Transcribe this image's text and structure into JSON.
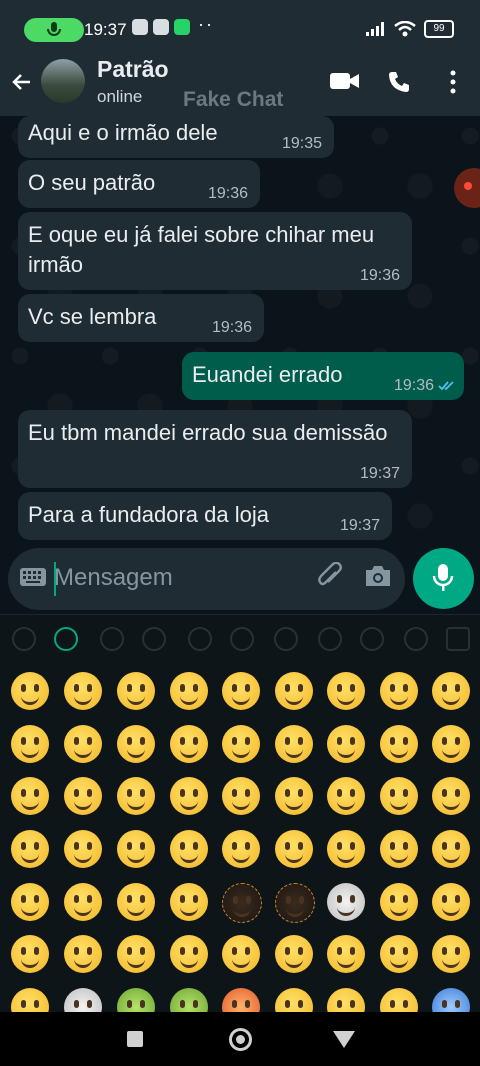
{
  "status_bar": {
    "time": "19:37",
    "battery": "99"
  },
  "header": {
    "contact_name": "Patrão",
    "presence": "online",
    "watermark": "Fake Chat"
  },
  "messages": [
    {
      "direction": "in",
      "text": "Aqui e o irmão dele",
      "time": "19:35"
    },
    {
      "direction": "in",
      "text": "O seu patrão",
      "time": "19:36"
    },
    {
      "direction": "in",
      "text": "E oque eu já falei sobre chihar meu irmão",
      "time": "19:36"
    },
    {
      "direction": "in",
      "text": "Vc se lembra",
      "time": "19:36"
    },
    {
      "direction": "out",
      "text": "Euandei errado",
      "time": "19:36",
      "status": "read"
    },
    {
      "direction": "in",
      "text": "Eu tbm mandei errado sua demissão",
      "time": "19:37"
    },
    {
      "direction": "in",
      "text": "Para a fundadora da loja",
      "time": "19:37"
    }
  ],
  "composer": {
    "placeholder": "Mensagem"
  },
  "emoji_picker": {
    "active_category": "smileys",
    "categories": [
      "recent-icon",
      "smileys-icon",
      "animals-icon",
      "food-icon",
      "activities-icon",
      "travel-icon",
      "objects-icon",
      "symbols-icon",
      "flags-icon",
      "backspace-icon"
    ],
    "emojis": [
      "😀",
      "😃",
      "😄",
      "😁",
      "😆",
      "😅",
      "🤣",
      "😂",
      "🙂",
      "🙃",
      "🫠",
      "😉",
      "😊",
      "😇",
      "🥰",
      "😍",
      "🤩",
      "😘",
      "😗",
      "☺️",
      "😚",
      "😙",
      "🥲",
      "😋",
      "😛",
      "😜",
      "🤪",
      "😝",
      "🤑",
      "🤗",
      "🤭",
      "🫢",
      "🫣",
      "🤫",
      "🤔",
      "🫡",
      "🤐",
      "🤨",
      "😐",
      "😑",
      "😶",
      "🫥",
      "😶‍🌫️",
      "😏",
      "😒",
      "🙄",
      "😬",
      "😮‍💨",
      "🤥",
      "🫨",
      "😌",
      "😔",
      "😪",
      "🤤",
      "😴",
      "😷",
      "🤒",
      "🤕",
      "🤢",
      "🤮",
      "🤧",
      "🥵",
      "🥶"
    ]
  },
  "colors": {
    "header": "#1f2c34",
    "chat_bg": "#0b141a",
    "incoming": "#1f2c34",
    "outgoing": "#005c4b",
    "accent": "#00a884"
  }
}
